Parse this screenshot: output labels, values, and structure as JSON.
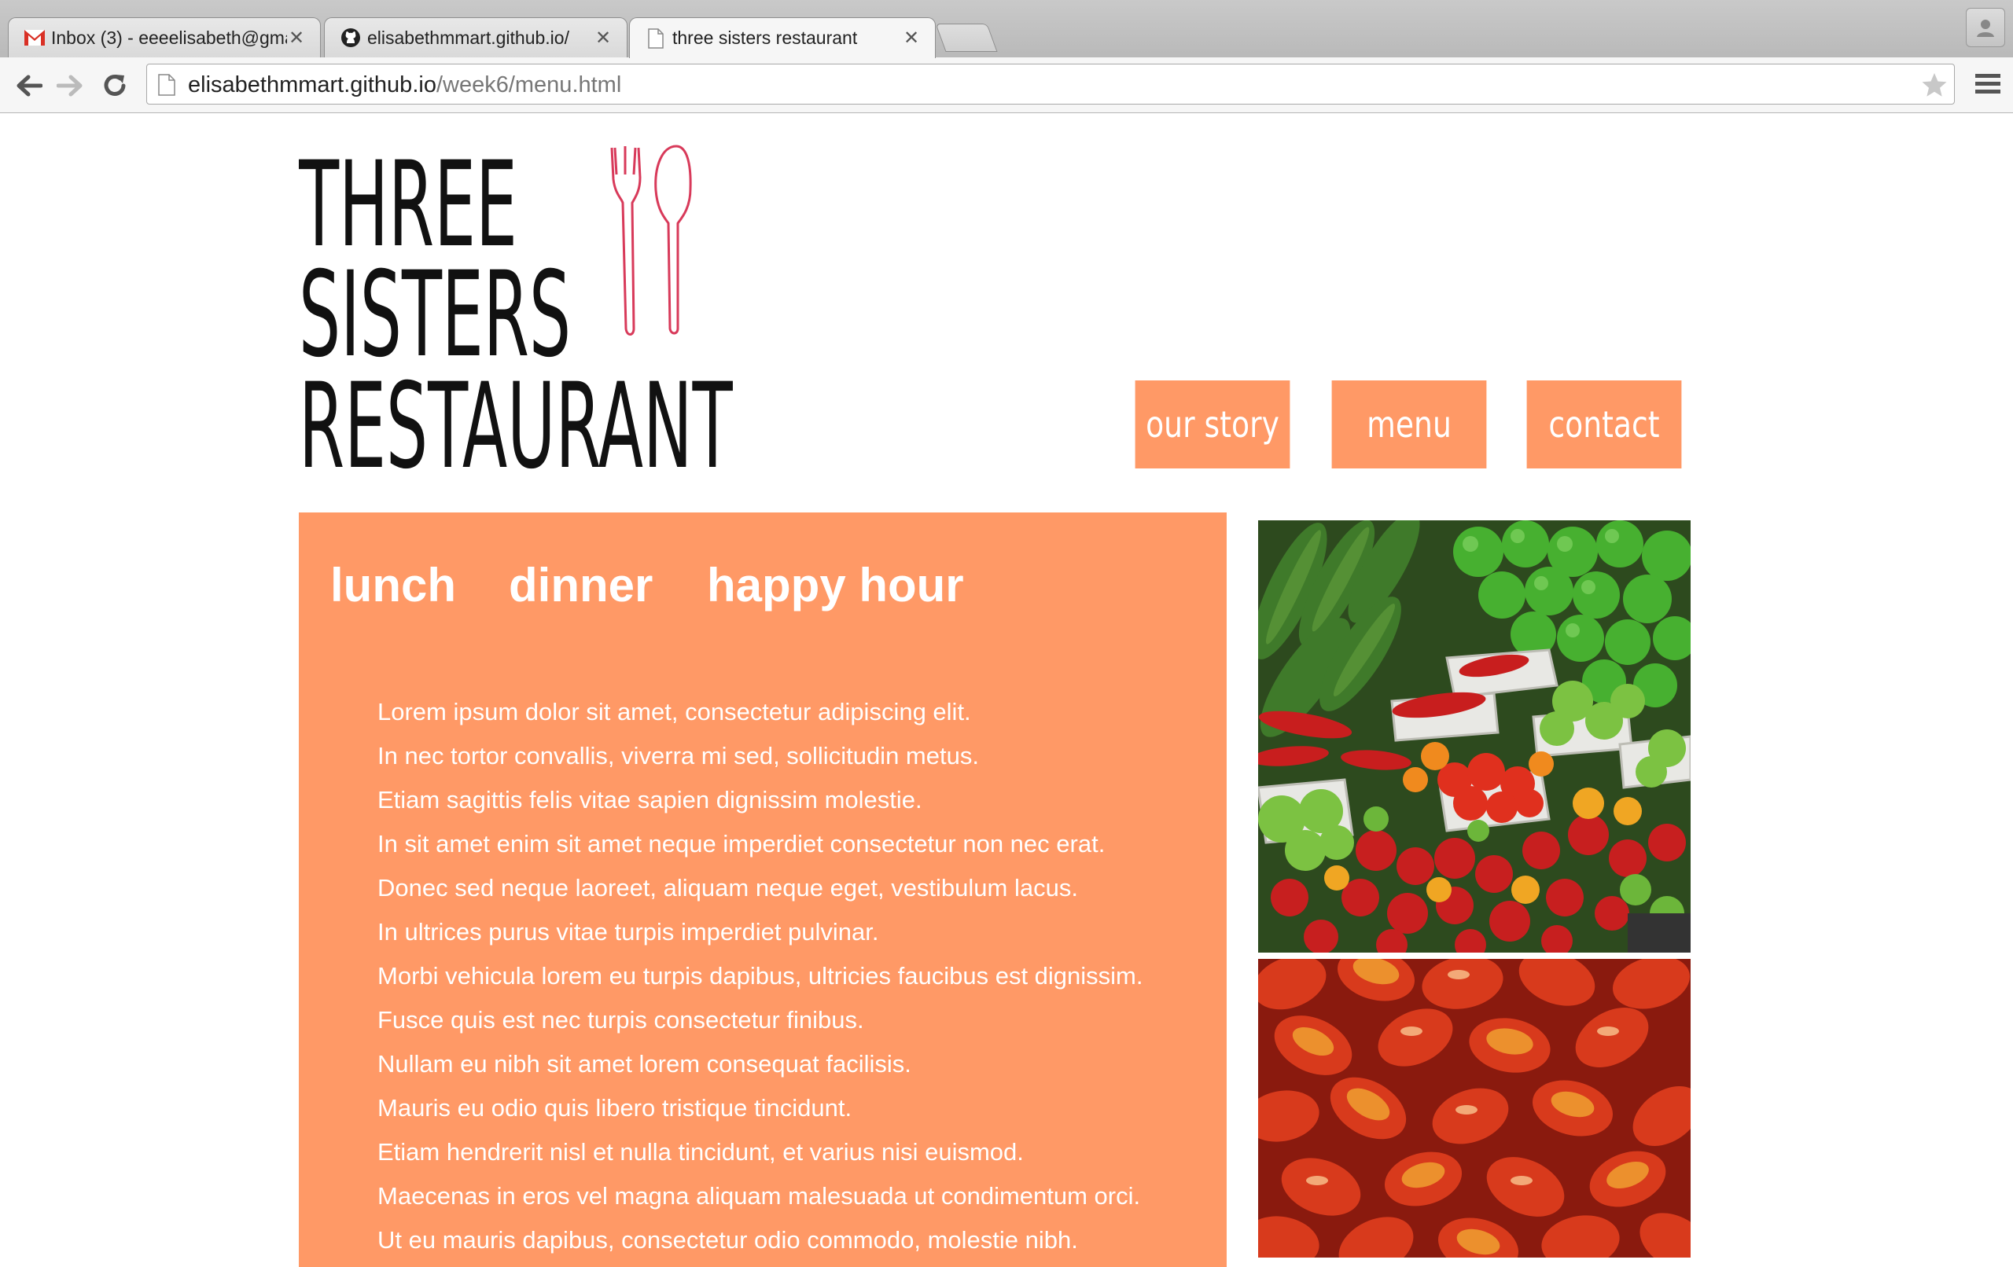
{
  "browser": {
    "tabs": [
      {
        "title": "Inbox (3) - eeeelisabeth@gmail.com",
        "icon": "gmail-icon"
      },
      {
        "title": "elisabethmmart.github.io/",
        "icon": "github-icon"
      },
      {
        "title": "three sisters restaurant",
        "icon": "page-icon",
        "active": true
      }
    ],
    "address": {
      "host": "elisabethmmart.github.io",
      "path": "/week6/menu.html"
    }
  },
  "page": {
    "logo": {
      "line1": "THREE",
      "line2": "SISTERS",
      "line3": "RESTAURANT"
    },
    "nav": [
      {
        "label": "our story"
      },
      {
        "label": "menu"
      },
      {
        "label": "contact"
      }
    ],
    "menu_tabs": [
      {
        "label": "lunch"
      },
      {
        "label": "dinner"
      },
      {
        "label": "happy hour"
      }
    ],
    "menu_lines": [
      "Lorem ipsum dolor sit amet, consectetur adipiscing elit.",
      "In nec tortor convallis, viverra mi sed, sollicitudin metus.",
      "Etiam sagittis felis vitae sapien dignissim molestie.",
      "In sit amet enim sit amet neque imperdiet consectetur non nec erat.",
      "Donec sed neque laoreet, aliquam neque eget, vestibulum lacus.",
      "In ultrices purus vitae turpis imperdiet pulvinar.",
      "Morbi vehicula lorem eu turpis dapibus, ultricies faucibus est dignissim.",
      "Fusce quis est nec turpis consectetur finibus.",
      "Nullam eu nibh sit amet lorem consequat facilisis.",
      "Mauris eu odio quis libero tristique tincidunt.",
      "Etiam hendrerit nisl et nulla tincidunt, et varius nisi euismod.",
      "Maecenas in eros vel magna aliquam malesuada ut condimentum orci.",
      "Ut eu mauris dapibus, consectetur odio commodo, molestie nibh."
    ],
    "colors": {
      "accent": "#ff9966",
      "logo_ink": "#111111",
      "utensils": "#d83a5a"
    }
  }
}
